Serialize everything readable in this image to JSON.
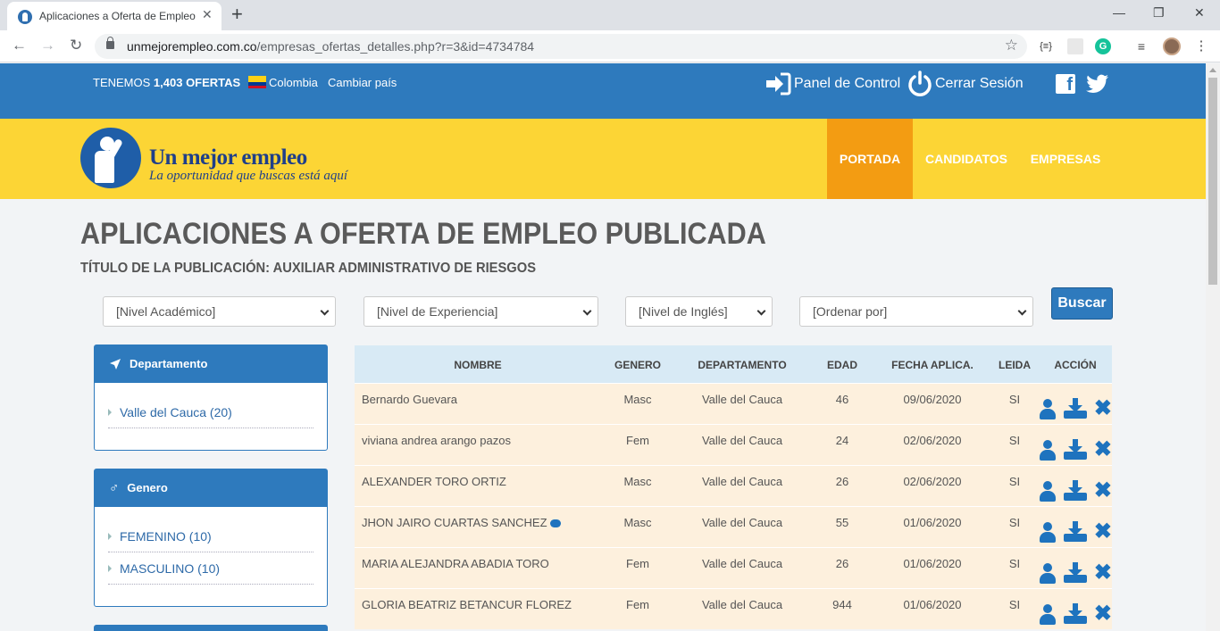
{
  "browser": {
    "tab_title": "Aplicaciones a Oferta de Empleo",
    "url_host": "unmejorempleo.com.co",
    "url_path": "/empresas_ofertas_detalles.php?r=3&id=4734784"
  },
  "topbar": {
    "offers_prefix": "TENEMOS",
    "offers_count": "1,403 OFERTAS",
    "country": "Colombia",
    "change_country": "Cambiar país",
    "panel": "Panel de Control",
    "logout": "Cerrar Sesión"
  },
  "header": {
    "logo_text": "Un mejor empleo",
    "logo_slogan": "La oportunidad que buscas está aquí",
    "nav": [
      "PORTADA",
      "CANDIDATOS",
      "EMPRESAS"
    ]
  },
  "page": {
    "title": "APLICACIONES A OFERTA DE EMPLEO PUBLICADA",
    "subtitle": "TÍTULO DE LA PUBLICACIÓN: AUXILIAR ADMINISTRATIVO DE RIESGOS"
  },
  "filters": {
    "academic": "[Nivel Académico]",
    "experience": "[Nivel de Experiencia]",
    "english": "[Nivel de Inglés]",
    "order": "[Ordenar por]",
    "search": "Buscar"
  },
  "sidebar": {
    "department": {
      "title": "Departamento",
      "items": [
        "Valle del Cauca (20)"
      ]
    },
    "gender": {
      "title": "Genero",
      "items": [
        "FEMENINO (10)",
        "MASCULINO (10)"
      ]
    }
  },
  "table": {
    "headers": [
      "NOMBRE",
      "GENERO",
      "DEPARTAMENTO",
      "EDAD",
      "FECHA APLICA.",
      "LEIDA",
      "ACCIÓN"
    ],
    "rows": [
      {
        "name": "Bernardo Guevara",
        "gender": "Masc",
        "dept": "Valle del Cauca",
        "age": "46",
        "date": "09/06/2020",
        "read": "SI"
      },
      {
        "name": "viviana andrea arango pazos",
        "gender": "Fem",
        "dept": "Valle del Cauca",
        "age": "24",
        "date": "02/06/2020",
        "read": "SI"
      },
      {
        "name": "ALEXANDER TORO ORTIZ",
        "gender": "Masc",
        "dept": "Valle del Cauca",
        "age": "26",
        "date": "02/06/2020",
        "read": "SI"
      },
      {
        "name": "JHON JAIRO CUARTAS SANCHEZ",
        "gender": "Masc",
        "dept": "Valle del Cauca",
        "age": "55",
        "date": "01/06/2020",
        "read": "SI"
      },
      {
        "name": "MARIA ALEJANDRA ABADIA TORO",
        "gender": "Fem",
        "dept": "Valle del Cauca",
        "age": "26",
        "date": "01/06/2020",
        "read": "SI"
      },
      {
        "name": "GLORIA BEATRIZ BETANCUR FLOREZ",
        "gender": "Fem",
        "dept": "Valle del Cauca",
        "age": "944",
        "date": "01/06/2020",
        "read": "SI"
      }
    ]
  },
  "colors": {
    "topbar": "#2e7abd",
    "header": "#fcd535",
    "nav_active": "#f39c12",
    "row_bg": "#fdf0dd",
    "thead_bg": "#d8eaf5"
  }
}
